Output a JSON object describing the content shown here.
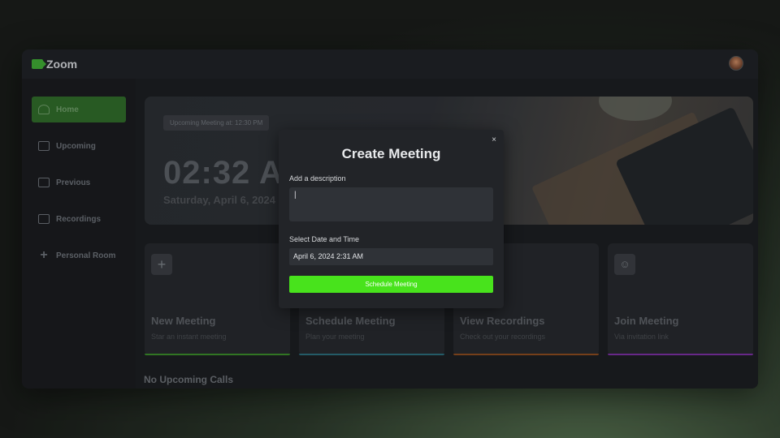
{
  "app": {
    "name": "Zoom"
  },
  "sidebar": {
    "items": [
      {
        "label": "Home",
        "icon": "home-icon",
        "active": true
      },
      {
        "label": "Upcoming",
        "icon": "calendar-icon"
      },
      {
        "label": "Previous",
        "icon": "calendar-icon"
      },
      {
        "label": "Recordings",
        "icon": "video-icon"
      },
      {
        "label": "Personal Room",
        "icon": "plus-icon"
      }
    ]
  },
  "hero": {
    "badge": "Upcoming Meeting at: 12:30 PM",
    "time": "02:32 AM",
    "date": "Saturday, April 6, 2024"
  },
  "cards": [
    {
      "title": "New Meeting",
      "subtitle": "Star an instant meeting",
      "icon": "plus-icon",
      "accent": "#3a8a2a"
    },
    {
      "title": "Schedule Meeting",
      "subtitle": "Plan your meeting",
      "icon": "calendar-icon",
      "accent": "#2b6b7a"
    },
    {
      "title": "View Recordings",
      "subtitle": "Check out your recordings",
      "icon": "video-icon",
      "accent": "#8a4a1f"
    },
    {
      "title": "Join Meeting",
      "subtitle": "Via invitation link",
      "icon": "user-icon",
      "accent": "#7a2fa0"
    }
  ],
  "section": {
    "title": "No Upcoming Calls"
  },
  "modal": {
    "title": "Create Meeting",
    "close": "×",
    "description_label": "Add a description",
    "description_value": "|",
    "datetime_label": "Select Date and Time",
    "datetime_value": "April 6, 2024 2:31 AM",
    "submit_label": "Schedule Meeting"
  },
  "colors": {
    "accent": "#48e31c",
    "brand": "#3fa834"
  }
}
